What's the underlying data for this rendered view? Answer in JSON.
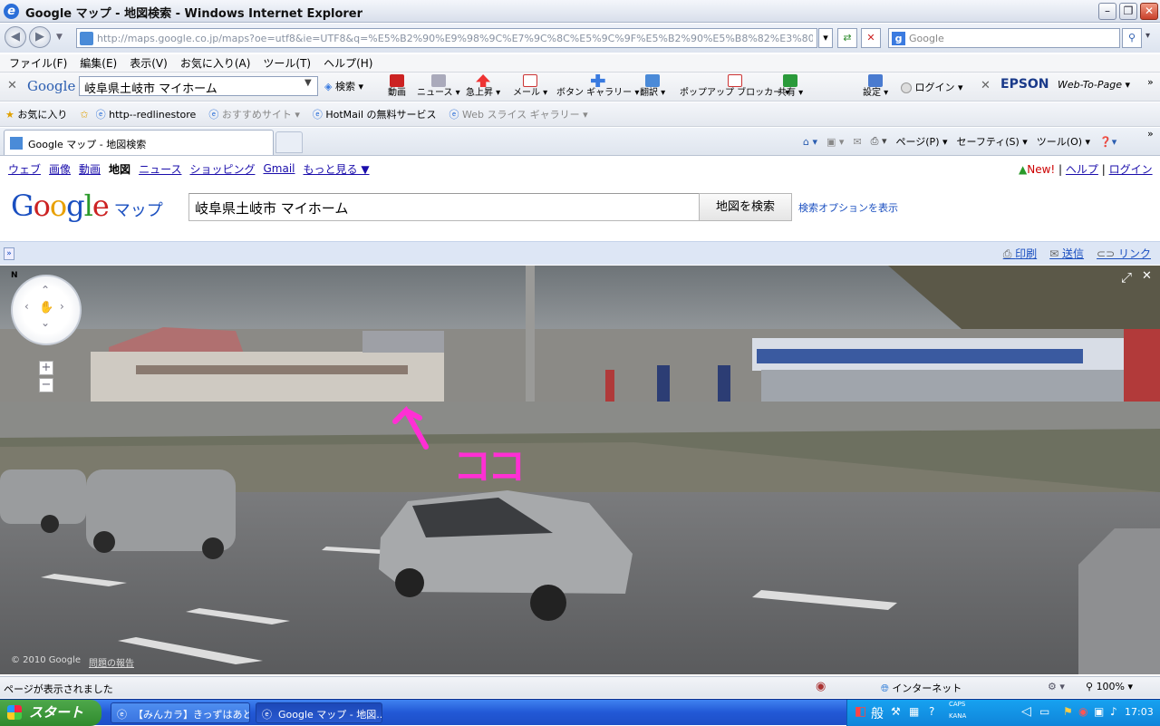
{
  "window": {
    "title": "Google マップ - 地図検索 - Windows Internet Explorer"
  },
  "address": {
    "url": "http://maps.google.co.jp/maps?oe=utf8&ie=UTF8&q=%E5%B2%90%E9%98%9C%E7%9C%8C%E5%9C%9F%E5%B2%90%E5%B8%82%E3%80%80%E3%83%9E%E3%82%A4%E",
    "search_placeholder": "Google"
  },
  "menu": [
    "ファイル(F)",
    "編集(E)",
    "表示(V)",
    "お気に入り(A)",
    "ツール(T)",
    "ヘルプ(H)"
  ],
  "gtoolbar": {
    "logo": "Google",
    "query": "岐阜県土岐市 マイホーム",
    "search": "検索",
    "items": [
      "動画",
      "ニュース",
      "急上昇",
      "メール",
      "ボタン ギャラリー",
      "翻訳",
      "ポップアップ ブロッカー",
      "共有"
    ],
    "settings": "設定",
    "login": "ログイン",
    "epson": "EPSON",
    "webtopage": "Web-To-Page"
  },
  "favbar": {
    "favorites": "お気に入り",
    "items": [
      "http--redlinestore",
      "おすすめサイト",
      "HotMail の無料サービス",
      "Web スライス ギャラリー"
    ]
  },
  "tab": {
    "title": "Google マップ - 地図検索"
  },
  "cmdbar": [
    "ページ(P)",
    "セーフティ(S)",
    "ツール(O)"
  ],
  "gnav": {
    "links": [
      "ウェブ",
      "画像",
      "動画",
      "地図",
      "ニュース",
      "ショッピング",
      "Gmail",
      "もっと見る ▼"
    ],
    "new": "New!",
    "help": "ヘルプ",
    "login": "ログイン"
  },
  "header": {
    "logo": "Google",
    "maps": "マップ",
    "query": "岐阜県土岐市 マイホーム",
    "button": "地図を検索",
    "advanced": "検索オプションを表示"
  },
  "mapbar": {
    "print": "印刷",
    "send": "送信",
    "link": "リンク"
  },
  "streetview": {
    "annotation": "ココ",
    "copyright": "© 2010 Google",
    "report": "問題の報告",
    "compass_n": "N"
  },
  "status": {
    "text": "ページが表示されました",
    "zone": "インターネット",
    "zoom": "100%"
  },
  "taskbar": {
    "start": "スタート",
    "tasks": [
      "【みんカラ】きっずはあと...",
      "Google マップ - 地図..."
    ],
    "ime": "般",
    "clock": "17:03",
    "caps": "CAPS",
    "kana": "KANA"
  }
}
